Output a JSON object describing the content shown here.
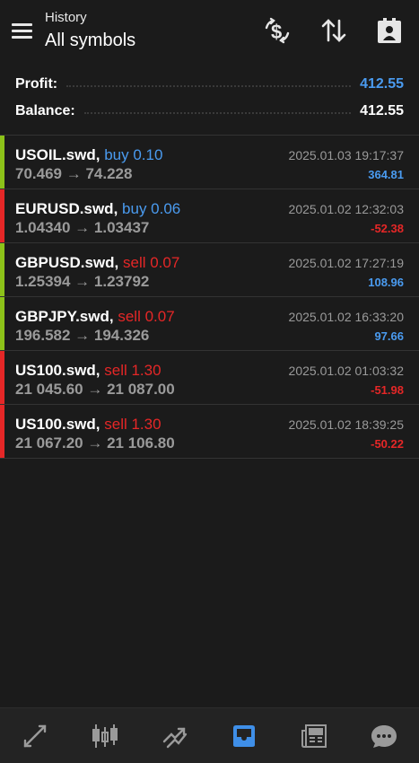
{
  "header": {
    "subtitle": "History",
    "title": "All symbols",
    "icons": [
      "menu-icon",
      "currency-exchange-icon",
      "sort-arrows-icon",
      "report-clipboard-icon"
    ]
  },
  "summary": {
    "profit_label": "Profit:",
    "profit_value": "412.55",
    "balance_label": "Balance:",
    "balance_value": "412.55"
  },
  "colors": {
    "buy": "#4a9bf0",
    "sell": "#e52727",
    "profit": "#4a9bf0",
    "loss": "#e52727",
    "bar_buy": "#8cc219",
    "bar_sell": "#e52727",
    "active_nav": "#3f8fe8"
  },
  "deals": [
    {
      "symbol": "USOIL.swd,",
      "side": "buy 0.10",
      "prices": "70.469 → 74.228",
      "time": "2025.01.03 19:17:37",
      "pl": "364.81",
      "type": "buy",
      "bar": "green"
    },
    {
      "symbol": "EURUSD.swd,",
      "side": "buy 0.06",
      "prices": "1.04340 → 1.03437",
      "time": "2025.01.02 12:32:03",
      "pl": "-52.38",
      "type": "buy",
      "bar": "red"
    },
    {
      "symbol": "GBPUSD.swd,",
      "side": "sell 0.07",
      "prices": "1.25394 → 1.23792",
      "time": "2025.01.02 17:27:19",
      "pl": "108.96",
      "type": "sell",
      "bar": "green"
    },
    {
      "symbol": "GBPJPY.swd,",
      "side": "sell 0.07",
      "prices": "196.582 → 194.326",
      "time": "2025.01.02 16:33:20",
      "pl": "97.66",
      "type": "sell",
      "bar": "green"
    },
    {
      "symbol": "US100.swd,",
      "side": "sell 1.30",
      "prices": "21 045.60 → 21 087.00",
      "time": "2025.01.02 01:03:32",
      "pl": "-51.98",
      "type": "sell",
      "bar": "red"
    },
    {
      "symbol": "US100.swd,",
      "side": "sell 1.30",
      "prices": "21 067.20 → 21 106.80",
      "time": "2025.01.02 18:39:25",
      "pl": "-50.22",
      "type": "sell",
      "bar": "red"
    }
  ],
  "bottom_nav": [
    "quotes-icon",
    "chart-candles-icon",
    "trade-icon",
    "history-inbox-icon",
    "news-icon",
    "chat-icon"
  ]
}
